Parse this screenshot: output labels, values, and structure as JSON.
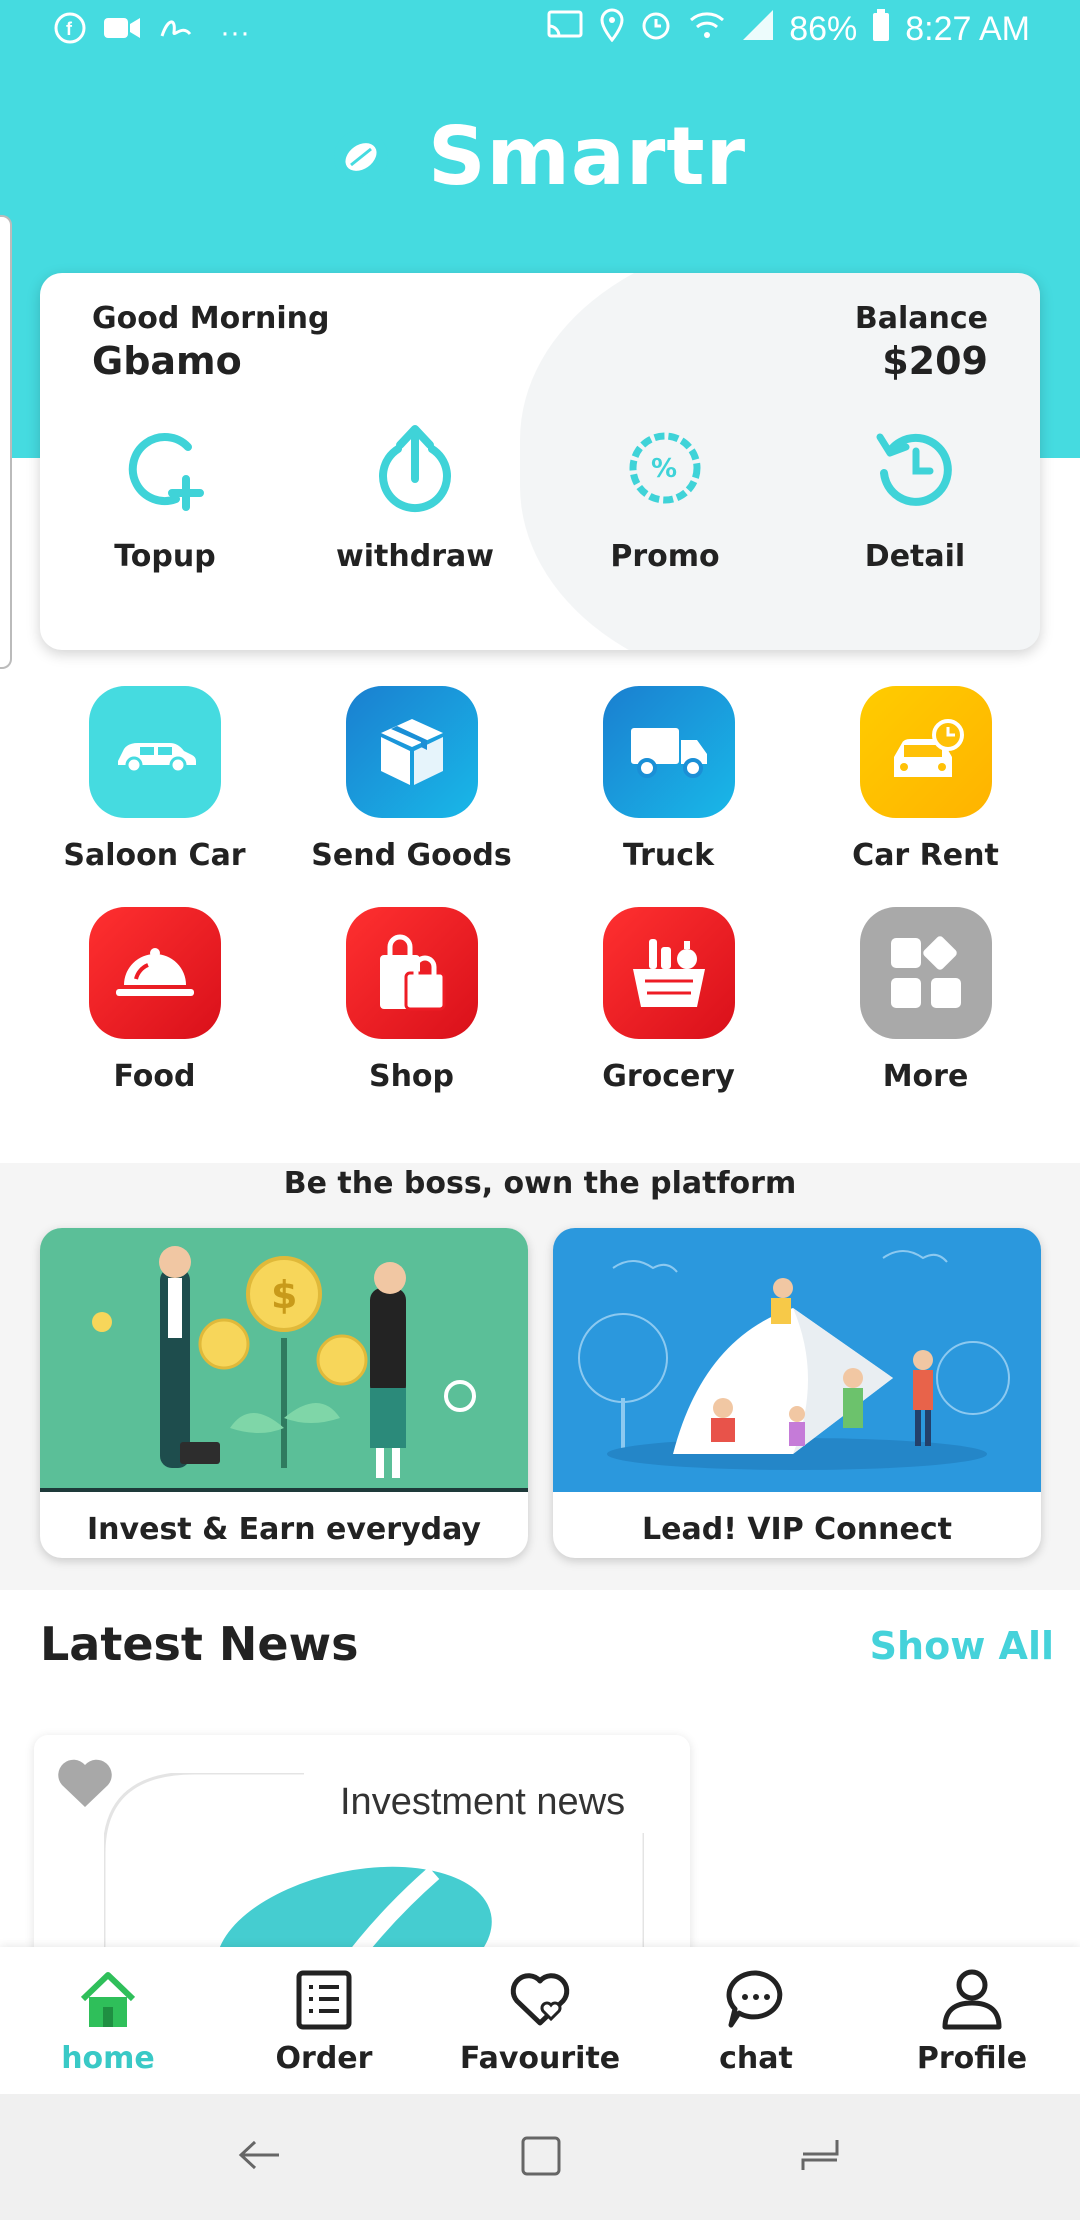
{
  "status_bar": {
    "battery": "86%",
    "time": "8:27 AM",
    "more": "···",
    "icons_left": [
      "facebook-icon",
      "video-icon",
      "signature-icon"
    ],
    "icons_right": [
      "cast-icon",
      "location-icon",
      "alarm-icon",
      "wifi-icon",
      "signal-icon",
      "battery-icon"
    ]
  },
  "header": {
    "title": "Smartr"
  },
  "wallet": {
    "greeting": "Good Morning",
    "name": "Gbamo",
    "balance_label": "Balance",
    "balance_value": "$209",
    "actions": [
      {
        "label": "Topup",
        "icon": "topup-icon"
      },
      {
        "label": "withdraw",
        "icon": "withdraw-icon"
      },
      {
        "label": "Promo",
        "icon": "promo-icon"
      },
      {
        "label": "Detail",
        "icon": "history-icon"
      }
    ]
  },
  "services": [
    {
      "label": "Saloon Car",
      "icon": "car-icon",
      "color": "#45dbe0"
    },
    {
      "label": "Send Goods",
      "icon": "package-icon",
      "color": "#1a8fd6"
    },
    {
      "label": "Truck",
      "icon": "truck-icon",
      "color": "#1a8fd6"
    },
    {
      "label": "Car Rent",
      "icon": "car-rent-icon",
      "color": "#ffc107"
    },
    {
      "label": "Food",
      "icon": "cloche-icon",
      "color": "#ee1c25"
    },
    {
      "label": "Shop",
      "icon": "shopping-bag-icon",
      "color": "#ee1c25"
    },
    {
      "label": "Grocery",
      "icon": "grocery-basket-icon",
      "color": "#ee1c25"
    },
    {
      "label": "More",
      "icon": "grid-icon",
      "color": "#a9a9a9"
    }
  ],
  "promo": {
    "title": "Be the boss, own the platform",
    "cards": [
      {
        "label": "Invest & Earn everyday",
        "color": "#5bbf98"
      },
      {
        "label": "Lead! VIP Connect",
        "color": "#2b98dd"
      }
    ]
  },
  "news": {
    "title": "Latest News",
    "show_all": "Show All",
    "items": [
      {
        "label": "Investment news"
      }
    ]
  },
  "bottom_nav": {
    "items": [
      {
        "label": "home",
        "icon": "home-icon",
        "active": true
      },
      {
        "label": "Order",
        "icon": "order-list-icon"
      },
      {
        "label": "Favourite",
        "icon": "heart-icon"
      },
      {
        "label": "chat",
        "icon": "chat-icon"
      },
      {
        "label": "Profile",
        "icon": "profile-icon"
      }
    ]
  },
  "colors": {
    "accent": "#45dbe0",
    "active_nav": "#39c9c6",
    "red": "#ee1c25",
    "blue": "#1a8fd6",
    "yellow": "#ffc107"
  }
}
